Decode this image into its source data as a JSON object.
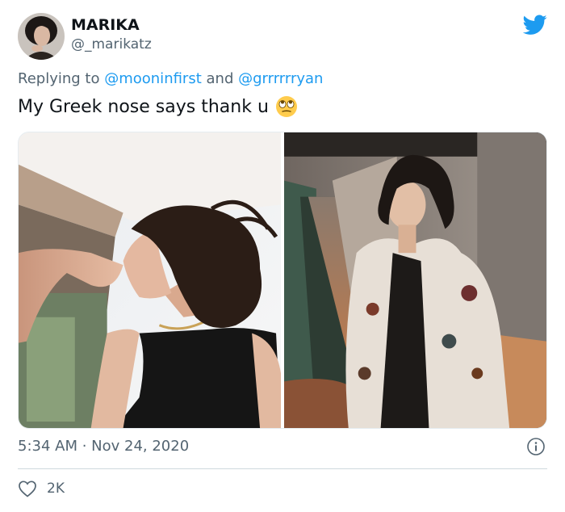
{
  "author": {
    "display_name": "MARIKA",
    "handle": "@_marikatz"
  },
  "reply": {
    "prefix": "Replying to",
    "mention_1": "@mooninfirst",
    "joiner": "and",
    "mention_2": "@grrrrrryan"
  },
  "tweet": {
    "text": "My Greek nose says thank u",
    "emoji": "face-with-rolling-eyes-emoji"
  },
  "meta": {
    "timestamp": "5:34 AM · Nov 24, 2020",
    "likes": "2K"
  },
  "colors": {
    "brand": "#1d9bf0",
    "secondary_text": "#536471",
    "divider": "#cfd9de"
  },
  "icons": [
    "twitter-bird-icon",
    "info-icon",
    "heart-icon"
  ]
}
